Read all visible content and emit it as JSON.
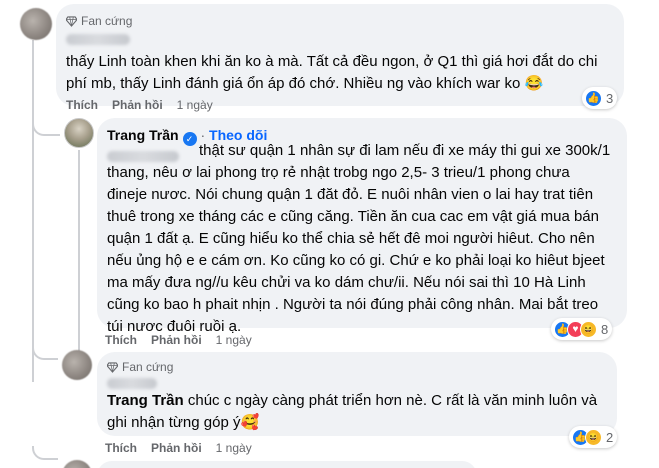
{
  "comment1": {
    "badge": "Fan cứng",
    "lines": [
      "thấy Linh toàn khen khi ăn ko à mà. Tất cả đều ngon, ở Q1 thì giá hơi đắt do chi",
      "phí mb, thấy Linh đánh giá ổn áp đó chớ. Nhiều ng vào khích war ko 😂"
    ],
    "like_label": "Thích",
    "reply_label": "Phản hồi",
    "time": "1 ngày",
    "reaction_count": "3",
    "reactions": [
      "like"
    ]
  },
  "comment2": {
    "author": "Trang Trần",
    "follow_label": "Theo dõi",
    "lines": [
      "thật sư quận 1 nhân sự đi lam nếu đi xe máy thi gui xe 300k/1",
      "thang, nêu ơ lai phong trọ rẻ nhật trobg ngo 2,5- 3 trieu/1 phong chưa",
      "đineje nươc. Nói chung quận 1 đăt đỏ. E nuôi nhân vien o lai hay trat tiên",
      "thuê trong xe tháng các e cũng căng. Tiền ăn cua cac em vật giá mua bán",
      "quận 1 đất ạ. E cũng hiểu ko thể chia sẻ hết đê moi người hiêut. Cho nên",
      "nếu ủng hộ e e cám ơn. Ko cũng ko có gi. Chứ e ko phải loại ko hiêut bjeet",
      "ma mấy đưa ng//u kêu chửi va ko dám chư/ii. Nếu nói sai thì 10 Hà Linh",
      "cũng ko bao h phait nhịn . Người ta nói đúng phải công nhân. Mai bắt treo",
      "túi nươc đuôi ruồi ạ."
    ],
    "like_label": "Thích",
    "reply_label": "Phản hồi",
    "time": "1 ngày",
    "reaction_count": "8",
    "reactions": [
      "like",
      "love",
      "haha"
    ]
  },
  "comment3": {
    "badge": "Fan cứng",
    "mention": "Trang Trần",
    "line1_rest": " chúc c ngày càng phát triển hơn nè. C rất là văn minh luôn và",
    "line2": "ghi nhận từng góp ý🥰",
    "like_label": "Thích",
    "reply_label": "Phản hồi",
    "time": "1 ngày",
    "reaction_count": "2",
    "reactions": [
      "like",
      "haha"
    ]
  },
  "colors": {
    "bubble": "#f0f2f5",
    "like": "#1877f2",
    "love": "#f33e58",
    "haha": "#f7b928",
    "follow": "#0866ff",
    "meta": "#65676b"
  }
}
